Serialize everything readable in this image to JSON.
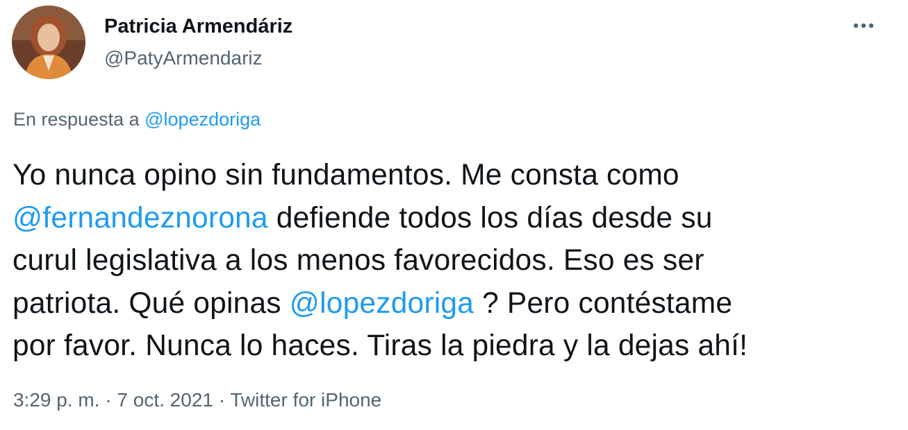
{
  "author": {
    "display_name": "Patricia Armendáriz",
    "handle": "@PatyArmendariz",
    "avatar_icon": "profile-photo"
  },
  "more_icon": "more-horizontal-icon",
  "reply": {
    "prefix": "En respuesta a ",
    "mention": "@lopezdoriga"
  },
  "tweet": {
    "line1": "Yo nunca opino sin fundamentos. Me consta como",
    "line2_mention": "@fernandeznorona",
    "line2_rest": " defiende todos los días desde su",
    "line3": "curul legislativa a los menos favorecidos. Eso es ser",
    "line4_start": "patriota. Qué opinas ",
    "line4_mention": "@lopezdoriga",
    "line4_rest": " ? Pero contéstame",
    "line5": "por favor. Nunca lo haces. Tiras la piedra y la dejas ahí!"
  },
  "meta": {
    "time": "3:29 p. m.",
    "separator": " · ",
    "date": "7 oct. 2021",
    "source": "Twitter for iPhone"
  },
  "colors": {
    "text": "#0f1419",
    "secondary": "#536471",
    "link": "#1d9bf0"
  }
}
